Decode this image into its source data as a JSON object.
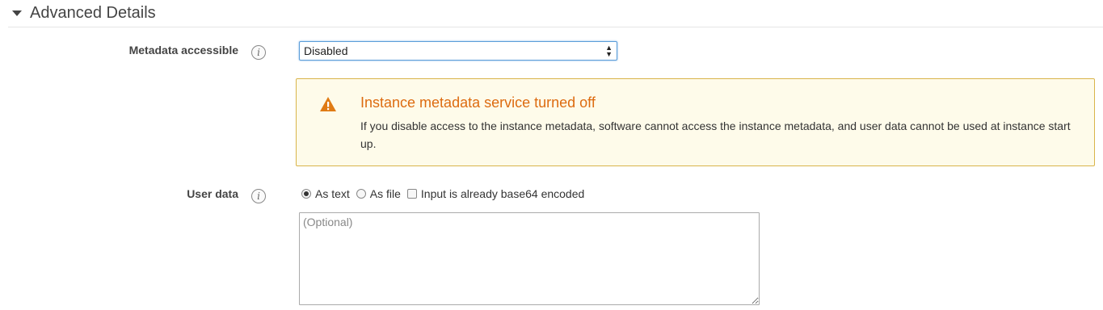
{
  "section": {
    "title": "Advanced Details",
    "caret_icon": "caret-down-icon"
  },
  "metadata_row": {
    "label": "Metadata accessible",
    "info_icon": "info-icon",
    "info_glyph": "i",
    "select_value": "Disabled"
  },
  "warning": {
    "icon": "warning-triangle-icon",
    "title": "Instance metadata service turned off",
    "text": "If you disable access to the instance metadata, software cannot access the instance metadata, and user data cannot be used at instance start up.",
    "title_color": "#dd6b10",
    "background_color": "#fefbea",
    "border_color": "#d9b44a"
  },
  "userdata_row": {
    "label": "User data",
    "info_glyph": "i",
    "options": {
      "as_text": {
        "label": "As text",
        "checked": true
      },
      "as_file": {
        "label": "As file",
        "checked": false
      },
      "base64": {
        "label": "Input is already base64 encoded",
        "checked": false
      }
    },
    "textarea_placeholder": "(Optional)",
    "textarea_value": ""
  }
}
